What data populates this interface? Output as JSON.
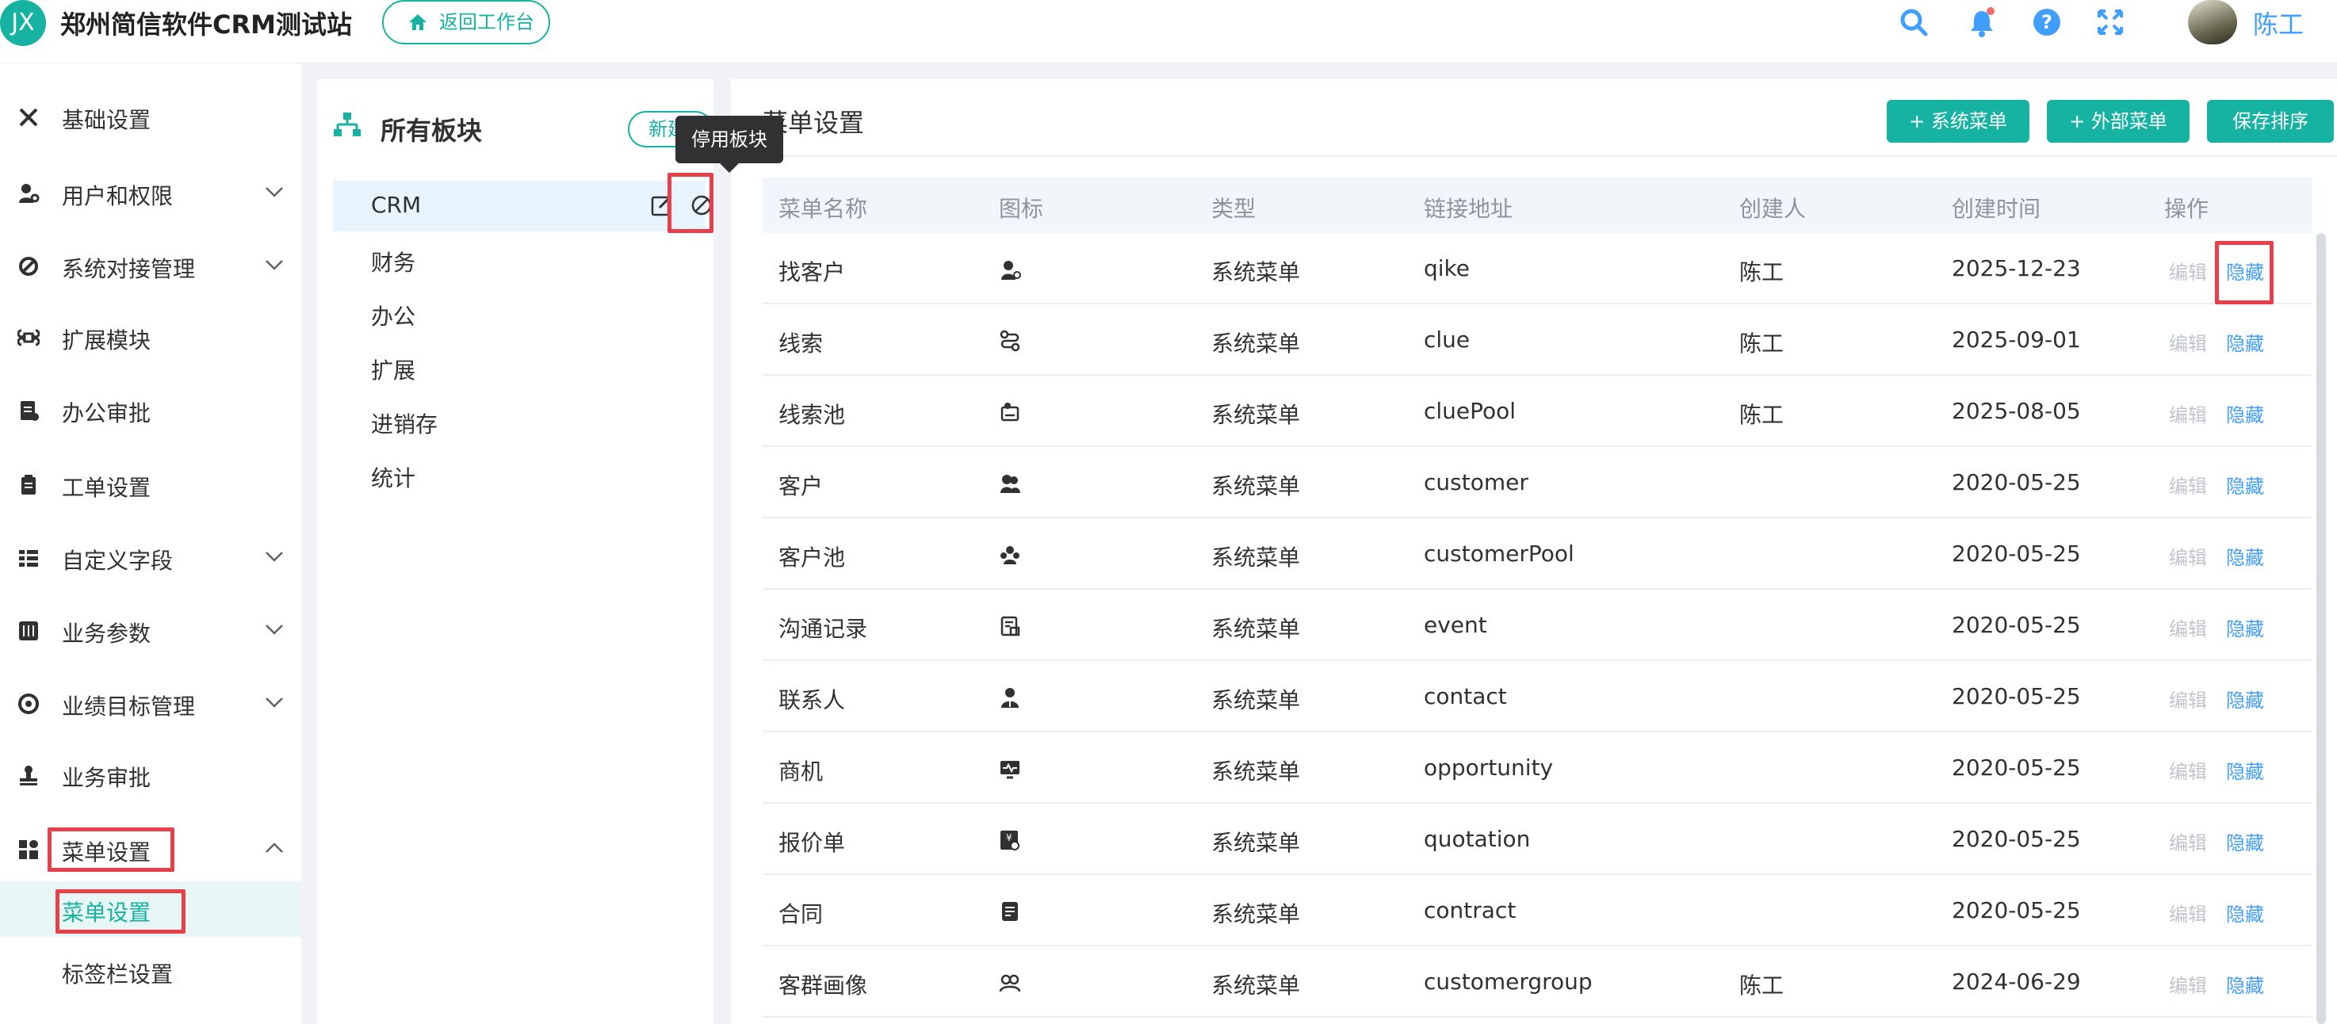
{
  "header": {
    "logo_text": "JX",
    "app_title": "郑州简信软件CRM测试站",
    "back_label": "返回工作台",
    "user_name": "陈工",
    "accent": "#16b3a2",
    "link_color": "#409eff"
  },
  "sidebar": {
    "items": [
      {
        "label": "基础设置",
        "icon": "tools-icon"
      },
      {
        "label": "用户和权限",
        "icon": "user-key-icon"
      },
      {
        "label": "系统对接管理",
        "icon": "plug-icon"
      },
      {
        "label": "扩展模块",
        "icon": "command-icon"
      },
      {
        "label": "办公审批",
        "icon": "doc-approve-icon"
      },
      {
        "label": "工单设置",
        "icon": "clipboard-icon"
      },
      {
        "label": "自定义字段",
        "icon": "list-icon"
      },
      {
        "label": "业务参数",
        "icon": "sliders-icon"
      },
      {
        "label": "业绩目标管理",
        "icon": "target-icon"
      },
      {
        "label": "业务审批",
        "icon": "stamp-icon"
      },
      {
        "label": "菜单设置",
        "icon": "grid-icon"
      }
    ],
    "subitems": [
      {
        "label": "菜单设置",
        "active": true
      },
      {
        "label": "标签栏设置",
        "active": false
      }
    ]
  },
  "modules": {
    "title": "所有板块",
    "new_label": "新建",
    "tooltip": "停用板块",
    "items": [
      "CRM",
      "财务",
      "办公",
      "扩展",
      "进销存",
      "统计"
    ]
  },
  "menu": {
    "title": "菜单设置",
    "buttons": {
      "system": "+ 系统菜单",
      "external": "+ 外部菜单",
      "save": "保存排序"
    },
    "columns": [
      "菜单名称",
      "图标",
      "类型",
      "链接地址",
      "创建人",
      "创建时间",
      "操作"
    ],
    "edit_label": "编辑",
    "hide_label": "隐藏",
    "rows": [
      {
        "name": "找客户",
        "icon": "find-customer-icon",
        "type": "系统菜单",
        "link": "qike",
        "creator": "陈工",
        "created": "2025-12-23"
      },
      {
        "name": "线索",
        "icon": "route-icon",
        "type": "系统菜单",
        "link": "clue",
        "creator": "陈工",
        "created": "2025-09-01"
      },
      {
        "name": "线索池",
        "icon": "pool-icon",
        "type": "系统菜单",
        "link": "cluePool",
        "creator": "陈工",
        "created": "2025-08-05"
      },
      {
        "name": "客户",
        "icon": "customers-icon",
        "type": "系统菜单",
        "link": "customer",
        "creator": "",
        "created": "2020-05-25"
      },
      {
        "name": "客户池",
        "icon": "customer-pool-icon",
        "type": "系统菜单",
        "link": "customerPool",
        "creator": "",
        "created": "2020-05-25"
      },
      {
        "name": "沟通记录",
        "icon": "record-icon",
        "type": "系统菜单",
        "link": "event",
        "creator": "",
        "created": "2020-05-25"
      },
      {
        "name": "联系人",
        "icon": "contact-icon",
        "type": "系统菜单",
        "link": "contact",
        "creator": "",
        "created": "2020-05-25"
      },
      {
        "name": "商机",
        "icon": "monitor-icon",
        "type": "系统菜单",
        "link": "opportunity",
        "creator": "",
        "created": "2020-05-25"
      },
      {
        "name": "报价单",
        "icon": "quotation-icon",
        "type": "系统菜单",
        "link": "quotation",
        "creator": "",
        "created": "2020-05-25"
      },
      {
        "name": "合同",
        "icon": "contract-icon",
        "type": "系统菜单",
        "link": "contract",
        "creator": "",
        "created": "2020-05-25"
      },
      {
        "name": "客群画像",
        "icon": "group-icon",
        "type": "系统菜单",
        "link": "customergroup",
        "creator": "陈工",
        "created": "2024-06-29"
      }
    ]
  }
}
